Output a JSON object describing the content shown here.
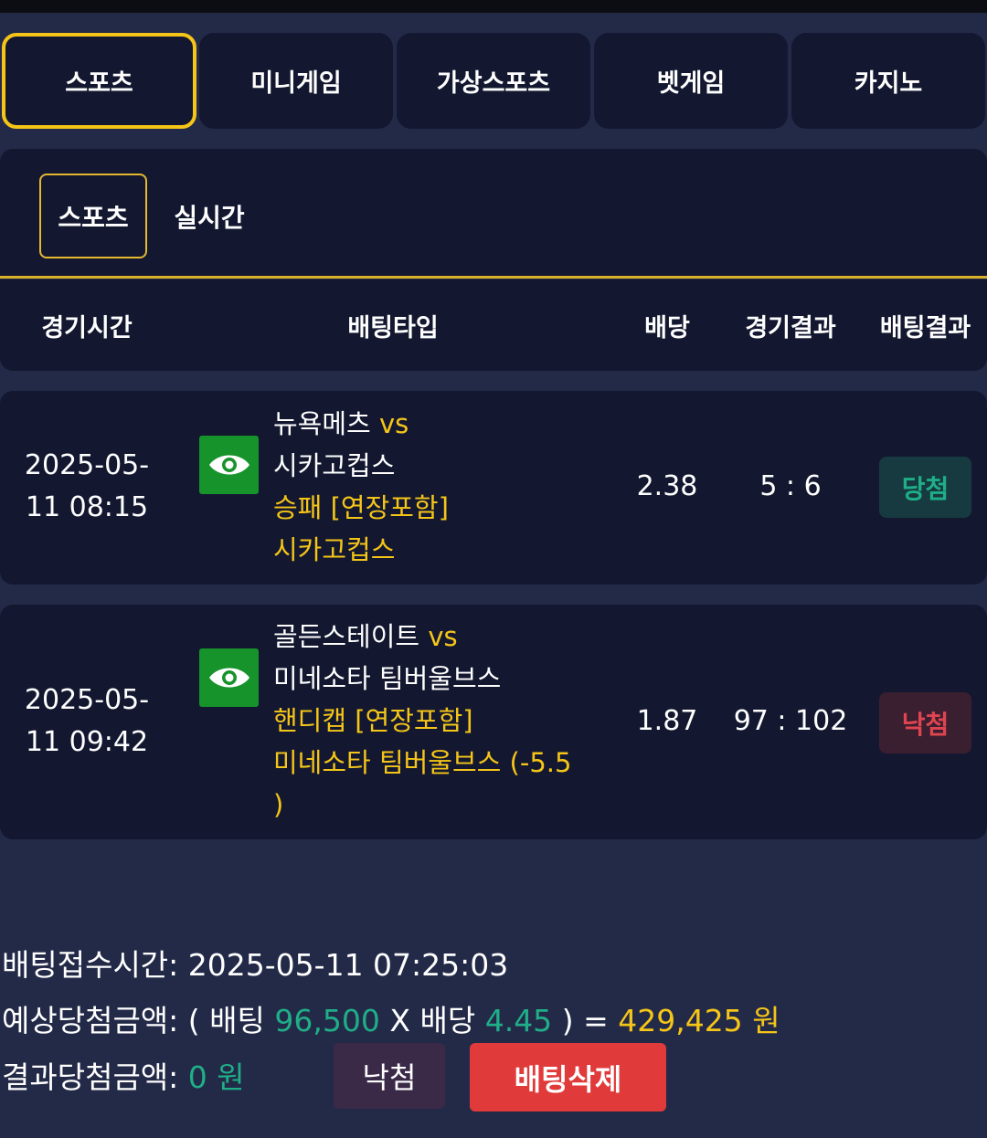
{
  "main_tabs": [
    {
      "label": "스포츠",
      "active": true
    },
    {
      "label": "미니게임",
      "active": false
    },
    {
      "label": "가상스포츠",
      "active": false
    },
    {
      "label": "벳게임",
      "active": false
    },
    {
      "label": "카지노",
      "active": false
    }
  ],
  "sub_tabs": [
    {
      "label": "스포츠",
      "active": true
    },
    {
      "label": "실시간",
      "active": false
    }
  ],
  "table": {
    "headers": {
      "time": "경기시간",
      "bet_type": "배팅타입",
      "odds": "배당",
      "game_result": "경기결과",
      "bet_result": "배팅결과"
    },
    "rows": [
      {
        "time_line1": "2025-05-",
        "time_line2": "11 08:15",
        "home": "뉴욕메츠",
        "vs": "vs",
        "away": "시카고컵스",
        "market": "승패 [연장포함]",
        "pick": "시카고컵스",
        "odds": "2.38",
        "score": "5 : 6",
        "result": "당첨",
        "result_status": "win"
      },
      {
        "time_line1": "2025-05-",
        "time_line2": "11 09:42",
        "home": "골든스테이트",
        "vs": "vs",
        "away": "미네소타 팀버울브스",
        "market": "핸디캡 [연장포함]",
        "pick": "미네소타 팀버울브스 (-5.5",
        "pick_cont": ")",
        "odds": "1.87",
        "score": "97 : 102",
        "result": "낙첨",
        "result_status": "lose"
      }
    ]
  },
  "summary": {
    "bet_time_label": "배팅접수시간:",
    "bet_time_value": "2025-05-11 07:25:03",
    "expected_label": "예상당첨금액:",
    "open_paren": "(",
    "bet_word": "배팅",
    "bet_amount": "96,500",
    "times": "X",
    "odds_word": "배당",
    "total_odds": "4.45",
    "close_paren": ")",
    "equals": "=",
    "expected_amount": "429,425",
    "won_unit": "원",
    "result_label": "결과당첨금액:",
    "result_amount": "0",
    "result_unit": "원"
  },
  "buttons": {
    "status_label": "낙첨",
    "delete_label": "배팅삭제"
  },
  "colors": {
    "background": "#232a48",
    "panel": "#131830",
    "accent_yellow": "#f5c518",
    "win_green": "#1fae87",
    "lose_red": "#e04450",
    "delete_button": "#e03a3a",
    "eye_button": "#16932b"
  },
  "icons": {
    "view_detail": "eye-icon"
  }
}
